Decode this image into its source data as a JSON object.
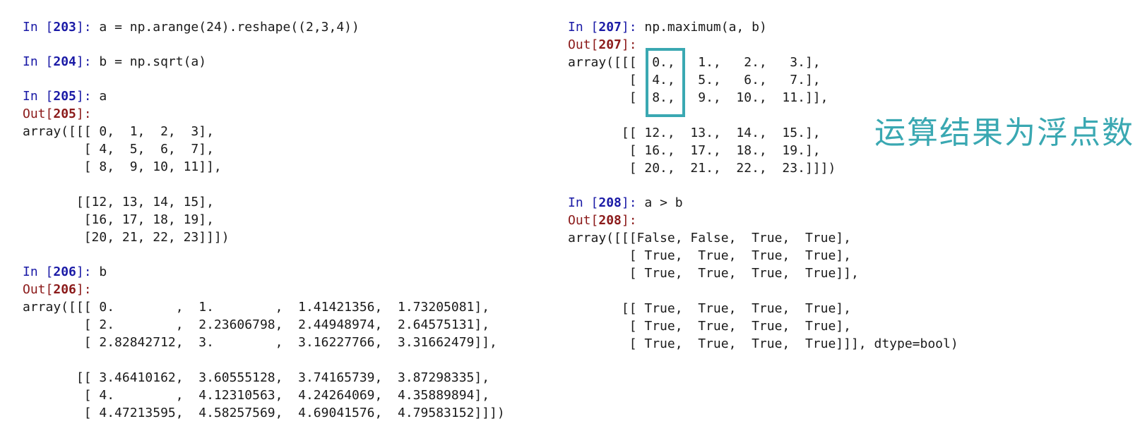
{
  "cells": [
    {
      "in_label": "In ",
      "number": "203",
      "code": "a = np.arange(24).reshape((2,3,4))",
      "output": []
    },
    {
      "in_label": "In ",
      "number": "204",
      "code": "b = np.sqrt(a)",
      "output": []
    },
    {
      "in_label": "In ",
      "number": "205",
      "code": "a",
      "out_label": "Out",
      "output": [
        "array([[[ 0,  1,  2,  3],",
        "        [ 4,  5,  6,  7],",
        "        [ 8,  9, 10, 11]],",
        "",
        "       [[12, 13, 14, 15],",
        "        [16, 17, 18, 19],",
        "        [20, 21, 22, 23]]])"
      ]
    },
    {
      "in_label": "In ",
      "number": "206",
      "code": "b",
      "out_label": "Out",
      "output": [
        "array([[[ 0.        ,  1.        ,  1.41421356,  1.73205081],",
        "        [ 2.        ,  2.23606798,  2.44948974,  2.64575131],",
        "        [ 2.82842712,  3.        ,  3.16227766,  3.31662479]],",
        "",
        "       [[ 3.46410162,  3.60555128,  3.74165739,  3.87298335],",
        "        [ 4.        ,  4.12310563,  4.24264069,  4.35889894],",
        "        [ 4.47213595,  4.58257569,  4.69041576,  4.79583152]]])"
      ]
    },
    {
      "in_label": "In ",
      "number": "207",
      "code": "np.maximum(a, b)",
      "out_label": "Out",
      "output": [
        "array([[[  0.,   1.,   2.,   3.],",
        "        [  4.,   5.,   6.,   7.],",
        "        [  8.,   9.,  10.,  11.]],",
        "",
        "       [[ 12.,  13.,  14.,  15.],",
        "        [ 16.,  17.,  18.,  19.],",
        "        [ 20.,  21.,  22.,  23.]]])"
      ]
    },
    {
      "in_label": "In ",
      "number": "208",
      "code": "a > b",
      "out_label": "Out",
      "output": [
        "array([[[False, False,  True,  True],",
        "        [ True,  True,  True,  True],",
        "        [ True,  True,  True,  True]],",
        "",
        "       [[ True,  True,  True,  True],",
        "        [ True,  True,  True,  True],",
        "        [ True,  True,  True,  True]]], dtype=bool)"
      ]
    }
  ],
  "annotation": "运算结果为浮点数",
  "colors": {
    "in_prompt": "#1a1aa6",
    "out_prompt": "#8b1a1a",
    "highlight": "#3aa8b2"
  }
}
